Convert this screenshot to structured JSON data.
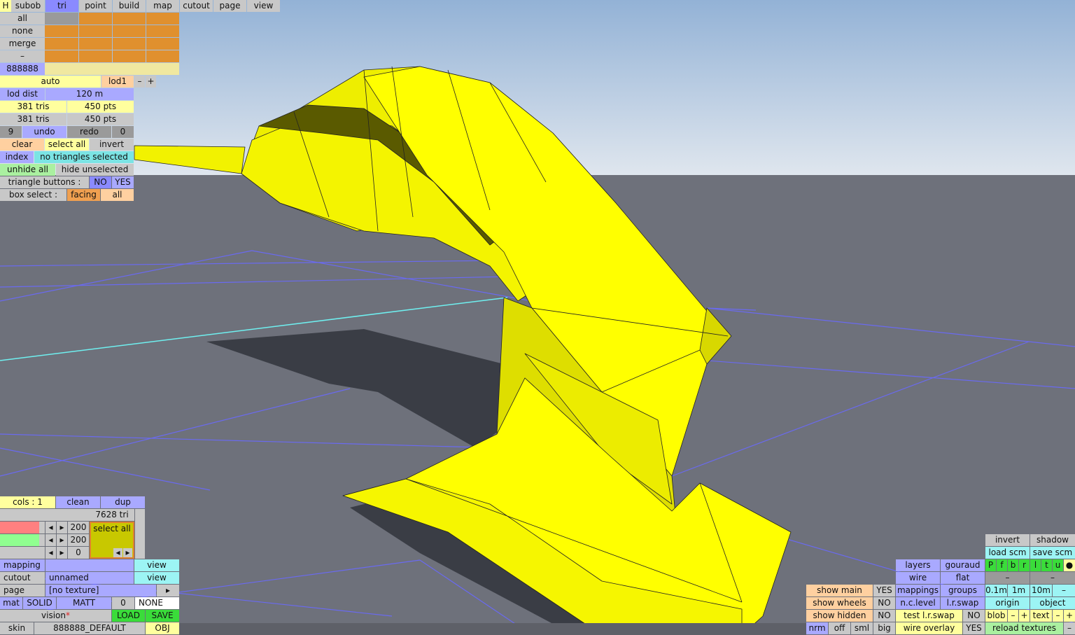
{
  "menu": {
    "h": "H",
    "tabs": [
      "subob",
      "tri",
      "point",
      "build",
      "map",
      "cutout",
      "page",
      "view"
    ],
    "active_tab": "tri"
  },
  "select_panel": {
    "rows": [
      "all",
      "none",
      "merge",
      "–"
    ],
    "color_value": "888888",
    "lod_mode": "auto",
    "lod_name": "lod1",
    "minus": "–",
    "plus": "+",
    "lod_dist_label": "lod dist",
    "lod_dist_value": "120 m",
    "tris_1": "381 tris",
    "pts_1": "450 pts",
    "tris_2": "381 tris",
    "pts_2": "450 pts",
    "undo_count": "9",
    "undo": "undo",
    "redo": "redo",
    "redo_count": "0",
    "clear": "clear",
    "select_all": "select all",
    "invert": "invert",
    "index": "index",
    "selection_status": "no triangles selected",
    "unhide_all": "unhide all",
    "hide_unselected": "hide unselected",
    "triangle_buttons_label": "triangle buttons :",
    "no": "NO",
    "yes": "YES",
    "box_select_label": "box select :",
    "facing": "facing",
    "all": "all"
  },
  "material_panel": {
    "cols": "cols : 1",
    "clean": "clean",
    "dup": "dup",
    "tri_count": "7628 tri",
    "select_all": "select all",
    "arrow_left": "◂",
    "arrow_right": "▸",
    "slider_values": [
      "200",
      "200",
      "0"
    ],
    "mapping": "mapping",
    "view": "view",
    "cutout": "cutout",
    "cutout_name": "unnamed",
    "page": "page",
    "page_texture": "[no texture]",
    "page_arrow": "▸",
    "mat": "mat",
    "solid": "SOLID",
    "matt": "MATT",
    "mat_num": "0",
    "none": "NONE",
    "vision": "vision",
    "vision_star": "*",
    "load": "LOAD",
    "save": "SAVE",
    "skin": "skin",
    "skin_name": "888888_DEFAULT",
    "obj": "OBJ"
  },
  "view_panel": {
    "invert": "invert",
    "shadow": "shadow",
    "load_scm": "load scm",
    "save_scm": "save scm",
    "layer_letters": [
      "P",
      "f",
      "b",
      "r",
      "l",
      "t",
      "u",
      "●"
    ],
    "layers": "layers",
    "gouraud": "gouraud",
    "wire": "wire",
    "flat": "flat",
    "dash": "–",
    "mappings": "mappings",
    "groups": "groups",
    "scale_01": "0.1m",
    "scale_1": "1m",
    "scale_10": "10m",
    "show_main": "show main",
    "show_main_val": "YES",
    "nc_level": "n.c.level",
    "lr_swap": "l.r.swap",
    "origin": "origin",
    "object": "object",
    "show_wheels": "show wheels",
    "show_wheels_val": "NO",
    "test_lr_swap": "test l.r.swap",
    "test_lr_swap_val": "NO",
    "blob": "blob",
    "text": "text",
    "show_hidden": "show hidden",
    "show_hidden_val": "NO",
    "wire_overlay": "wire overlay",
    "wire_overlay_val": "YES",
    "reload_textures": "reload textures",
    "nrm": "nrm",
    "off": "off",
    "sml": "sml",
    "big": "big"
  },
  "colors": {
    "sky_top": "#97b5d8",
    "ground": "#6e717b",
    "mesh_yellow": "#ffff00",
    "grid_line": "#6a6af0",
    "axis_line": "#6ff0f0"
  }
}
